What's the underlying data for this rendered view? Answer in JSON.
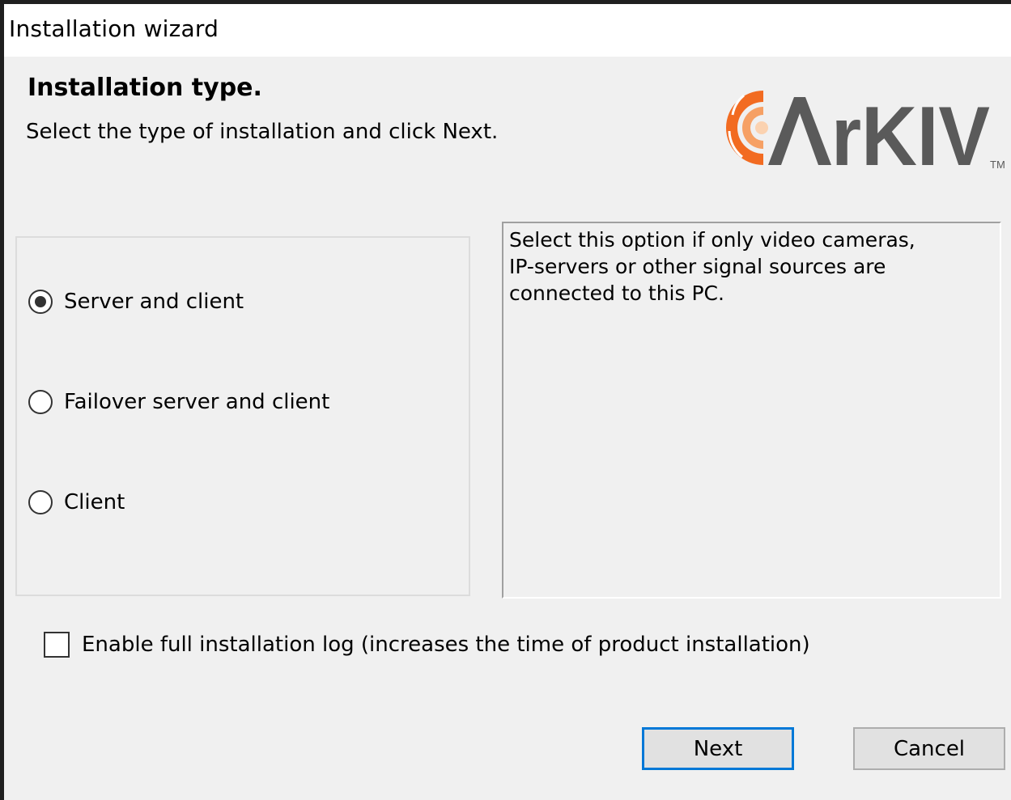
{
  "window": {
    "title": "Installation wizard"
  },
  "header": {
    "heading": "Installation type.",
    "subheading": "Select the type of installation and click Next.",
    "logo_text": "ARKIV",
    "logo_tm": "TM"
  },
  "installation_types": {
    "options": [
      {
        "label": "Server and client",
        "selected": true
      },
      {
        "label": "Failover server and client",
        "selected": false
      },
      {
        "label": "Client",
        "selected": false
      }
    ]
  },
  "description": {
    "text": "Select this option if only video cameras,\nIP-servers or other signal sources are\nconnected to this PC."
  },
  "log_option": {
    "label": "Enable full installation log (increases the time of product installation)",
    "checked": false
  },
  "buttons": {
    "next": "Next",
    "cancel": "Cancel"
  },
  "colors": {
    "logo_orange": "#f26b21",
    "logo_gray": "#5a5a5a",
    "focus_border": "#0078d7",
    "window_bg": "#f0f0f0"
  },
  "icons": {
    "selected_radio": "radio-checked-icon",
    "unselected_radio": "radio-unchecked-icon",
    "log_checkbox": "checkbox-unchecked-icon"
  }
}
